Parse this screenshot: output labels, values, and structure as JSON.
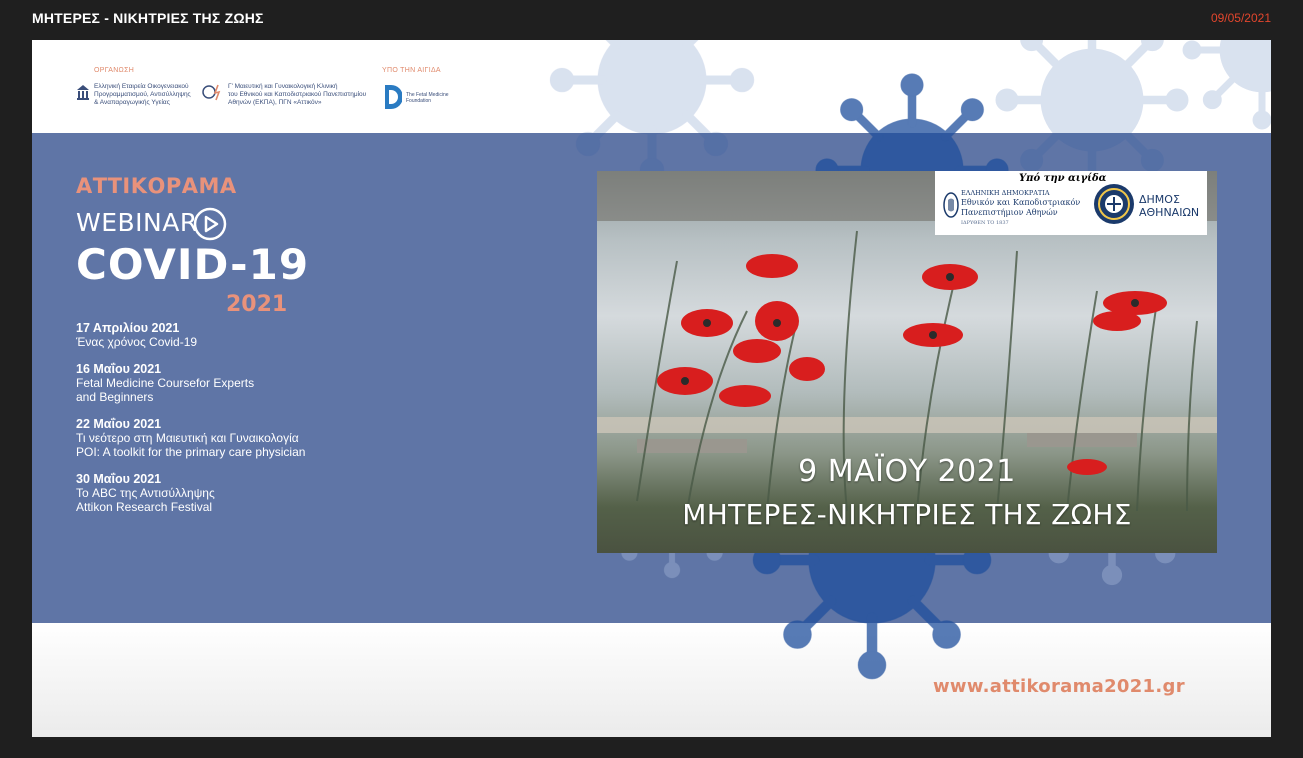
{
  "header": {
    "title": "ΜΗΤΕΡΕΣ - ΝΙΚΗΤΡΙΕΣ ΤΗΣ ΖΩΗΣ",
    "date": "09/05/2021"
  },
  "slide": {
    "organizers_label": "ΟΡΓΑΝΩΣΗ",
    "patronage_label": "ΥΠΟ ΤΗΝ ΑΙΓΙΔΑ",
    "org1": [
      "Ελληνική Εταιρεία Οικογενειακού",
      "Προγραμματισμού, Αντισύλληψης",
      "& Αναπαραγωγικής Υγείας"
    ],
    "org2": [
      "Γ' Μαιευτική και Γυναικολογική Κλινική",
      "του Εθνικού και Καποδιστριακού Πανεπιστημίου",
      "Αθηνών (ΕΚΠΑ), ΠΓΝ «Αττικόν»"
    ],
    "org3": [
      "The Fetal Medicine",
      "Foundation"
    ],
    "brand": {
      "line1": "ΑΤΤΙΚΟΡΑΜΑ",
      "line2": "WEBINAR",
      "line3": "COVID-19",
      "year": "2021"
    },
    "events": [
      {
        "date": "17 Απριλίου 2021",
        "lines": [
          "Ένας χρόνος Covid-19"
        ]
      },
      {
        "date": "16 Μαΐου 2021",
        "lines": [
          "Fetal Medicine Coursefor Experts",
          "and Beginners"
        ]
      },
      {
        "date": "22 Μαΐου 2021",
        "lines": [
          "Τι νεότερο στη Μαιευτική και Γυναικολογία",
          "POI: A toolkit for the primary care physician"
        ]
      },
      {
        "date": "30 Μαΐου 2021",
        "lines": [
          "Το ABC της Αντισύλληψης",
          "Attikon Research Festival"
        ]
      }
    ],
    "poster": {
      "patronage_title": "Υπό την αιγίδα",
      "university": [
        "ΕΛΛΗΝΙΚΗ ΔΗΜΟΚΡΑΤΙΑ",
        "Εθνικόν και Καποδιστριακόν",
        "Πανεπιστήμιον Αθηνών",
        "ΙΔΡΥΘΕΝ ΤΟ 1837"
      ],
      "city": [
        "ΔΗΜΟΣ",
        "ΑΘΗΝΑΙΩΝ"
      ],
      "date": "9 ΜΑΪΟΥ 2021",
      "subtitle": "ΜΗΤΕΡΕΣ-ΝΙΚΗΤΡΙΕΣ ΤΗΣ ΖΩΗΣ"
    },
    "url": "www.attikorama2021.gr"
  },
  "colors": {
    "background": "#1f1f1f",
    "date_accent": "#e2462d",
    "band_blue": "#5f75a6",
    "brand_salmon": "#e9927b",
    "virus_blue": "#1f4f9c"
  }
}
